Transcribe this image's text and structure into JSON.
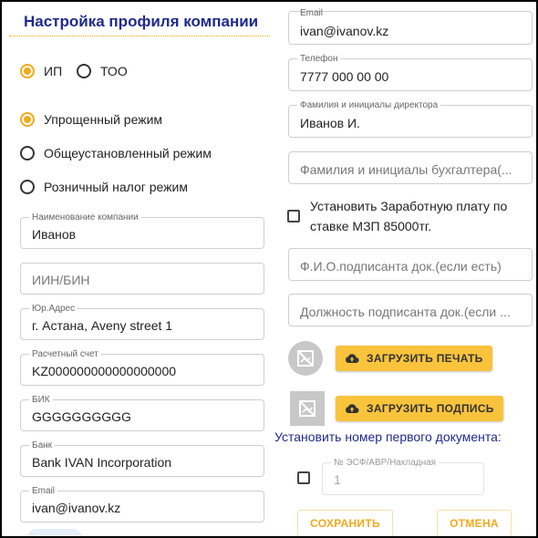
{
  "header": {
    "title": "Настройка профиля компании"
  },
  "entity_type": {
    "options": [
      {
        "label": "ИП",
        "selected": true
      },
      {
        "label": "ТОО",
        "selected": false
      }
    ]
  },
  "tax_regime": {
    "options": [
      {
        "label": "Упрощенный режим",
        "selected": true
      },
      {
        "label": "Общеустановленный режим",
        "selected": false
      },
      {
        "label": "Розничный налог режим",
        "selected": false
      }
    ]
  },
  "left_fields": {
    "company_name": {
      "label": "Наименование компании",
      "value": "Иванов"
    },
    "iin_bin": {
      "placeholder": "ИИН/БИН"
    },
    "legal_address": {
      "label": "Юр.Адрес",
      "value": "г. Астана, Aveny street 1"
    },
    "account": {
      "label": "Расчетный счет",
      "value": "KZ000000000000000000"
    },
    "bik": {
      "label": "БИК",
      "value": "GGGGGGGGGG"
    },
    "bank": {
      "label": "Банк",
      "value": "Bank IVAN Incorporation"
    },
    "email": {
      "label": "Email",
      "value": "ivan@ivanov.kz"
    }
  },
  "right_fields": {
    "email": {
      "label": "Email",
      "value": "ivan@ivanov.kz"
    },
    "phone": {
      "label": "Телефон",
      "value": "7777 000 00 00"
    },
    "director": {
      "label": "Фамилия и инициалы директора",
      "value": "Иванов И."
    },
    "accountant": {
      "placeholder": "Фамилия и инициалы бухгалтера(..."
    },
    "salary_checkbox": {
      "line1": "Установить Заработную плату по",
      "line2": "ставке МЗП 85000тг.",
      "checked": false
    },
    "signer_name": {
      "placeholder": "Ф.И.О.подписанта док.(если есть)"
    },
    "signer_position": {
      "placeholder": "Должность подписанта док.(если ..."
    }
  },
  "uploads": {
    "stamp_button": "ЗАГРУЗИТЬ ПЕЧАТЬ",
    "signature_button": "ЗАГРУЗИТЬ ПОДПИСЬ"
  },
  "doc_number": {
    "heading": "Установить номер первого документа:",
    "field_label": "№ ЭСФ/АВР/Накладная",
    "field_value": "1",
    "checked": false
  },
  "actions": {
    "save": "СОХРАНИТЬ",
    "cancel": "ОТМЕНА"
  },
  "colors": {
    "accent": "#f2a91c",
    "button_yellow": "#f9c33c",
    "title_blue": "#1f2a8c"
  }
}
